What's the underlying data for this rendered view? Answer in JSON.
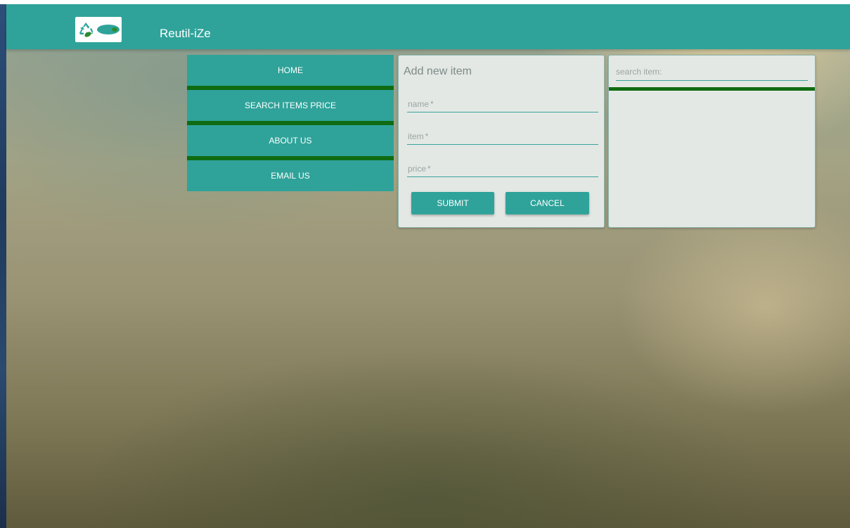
{
  "header": {
    "brand": "Reutil-iZe",
    "logo_text": "Reutil-iZe"
  },
  "nav": {
    "items": [
      {
        "label": "HOME"
      },
      {
        "label": "SEARCH ITEMS PRICE"
      },
      {
        "label": "ABOUT US"
      },
      {
        "label": "EMAIL US"
      }
    ]
  },
  "form": {
    "title": "Add new item",
    "fields": [
      {
        "label": "name",
        "required_mark": "*"
      },
      {
        "label": "item",
        "required_mark": "*"
      },
      {
        "label": "price",
        "required_mark": "*"
      }
    ],
    "submit_label": "SUBMIT",
    "cancel_label": "CANCEL"
  },
  "search": {
    "placeholder": "search item:"
  },
  "colors": {
    "accent": "#2fa39a",
    "divider": "#0f6b12",
    "card_bg": "#e3e8e5"
  },
  "icons": {
    "logo": "recycle-leaf-logo"
  }
}
